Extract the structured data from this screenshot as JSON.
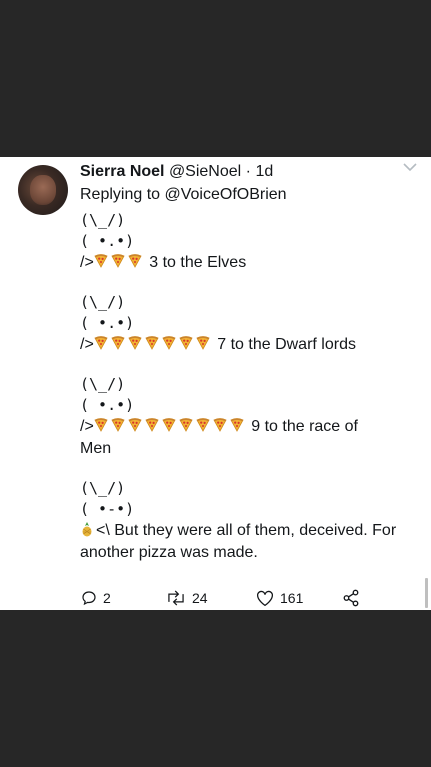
{
  "tweet": {
    "name": "Sierra Noel",
    "handle": "@SieNoel",
    "separator": "·",
    "time": "1d",
    "replying_prefix": "Replying to ",
    "replying_mention": "@VoiceOfOBrien",
    "blocks": [
      {
        "art1": "(\\_/)",
        "art2": "( •.•)",
        "prefix": "/>",
        "pizzas": 3,
        "text": " 3 to the Elves",
        "text2": ""
      },
      {
        "art1": "(\\_/)",
        "art2": "( •.•)",
        "prefix": "/>",
        "pizzas": 7,
        "text": " 7 to the Dwarf lords",
        "text2": ""
      },
      {
        "art1": "(\\_/)",
        "art2": "( •.•)",
        "prefix": "/>",
        "pizzas": 9,
        "text": " 9 to the race of",
        "text2": "Men"
      },
      {
        "art1": "(\\_/)",
        "art2": "( •-•)",
        "prefix": "<\\",
        "pizzas": 0,
        "text": " But they were all of them, deceived. For",
        "text2": "another pizza was made."
      }
    ],
    "actions": {
      "replies": "2",
      "retweets": "24",
      "likes": "161"
    },
    "icons": {
      "reply": "reply-icon",
      "retweet": "retweet-icon",
      "like": "heart-icon",
      "share": "share-icon",
      "more": "chevron-down-icon",
      "pizza": "pizza-slice-icon",
      "pineapple": "pineapple-icon"
    }
  }
}
